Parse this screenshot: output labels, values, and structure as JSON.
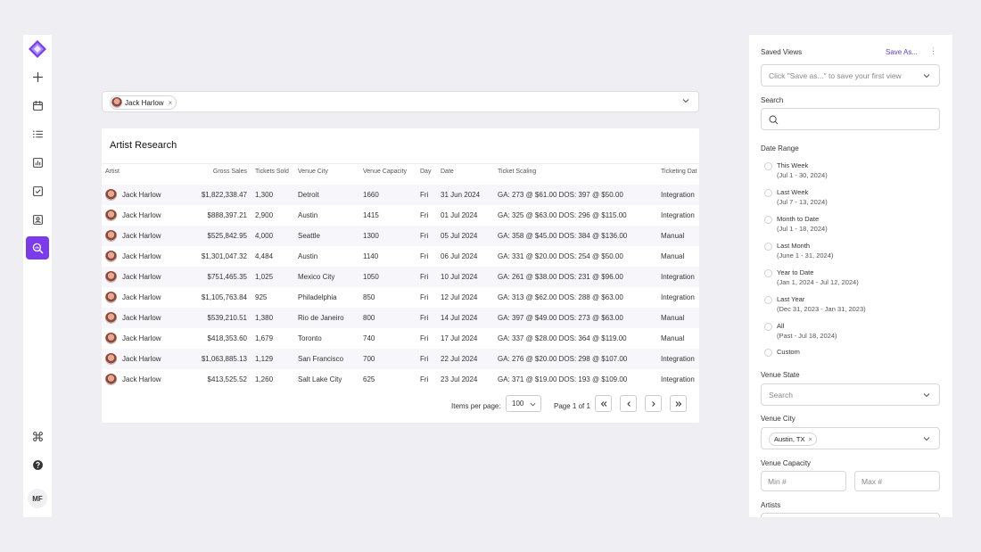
{
  "nav": {
    "items": [
      {
        "icon": "plus-icon"
      },
      {
        "icon": "calendar-icon"
      },
      {
        "icon": "list-icon"
      },
      {
        "icon": "chart-icon"
      },
      {
        "icon": "checkbox-icon"
      },
      {
        "icon": "contact-card-icon"
      },
      {
        "icon": "search-analytics-icon",
        "active": true
      }
    ],
    "bottom": [
      {
        "icon": "command-icon"
      },
      {
        "icon": "help-icon"
      }
    ],
    "user_initials": "MF"
  },
  "artist_filter": {
    "chip": "Jack Harlow"
  },
  "research": {
    "title": "Artist Research",
    "columns": [
      "Artist",
      "Gross Sales",
      "Tickets Sold",
      "Venue City",
      "Venue Capacity",
      "Day",
      "Date",
      "Ticket Scaling",
      "Ticketing Dat"
    ],
    "rows": [
      [
        "Jack Harlow",
        "$1,822,338.47",
        "1,300",
        "Detroit",
        "1660",
        "Fri",
        "31 Jun 2024",
        "GA: 273 @ $61.00 DOS: 397 @ $50.00",
        "Integration"
      ],
      [
        "Jack Harlow",
        "$888,397.21",
        "2,900",
        "Austin",
        "1415",
        "Fri",
        "01 Jul 2024",
        "GA: 325 @ $63.00 DOS: 296 @ $115.00",
        "Integration"
      ],
      [
        "Jack Harlow",
        "$525,842.95",
        "4,000",
        "Seattle",
        "1300",
        "Fri",
        "05 Jul 2024",
        "GA: 358 @ $45.00 DOS: 384 @ $136.00",
        "Manual"
      ],
      [
        "Jack Harlow",
        "$1,301,047.32",
        "4,484",
        "Austin",
        "1140",
        "Fri",
        "06 Jul 2024",
        "GA: 331 @ $20.00 DOS: 254 @ $50.00",
        "Manual"
      ],
      [
        "Jack Harlow",
        "$751,465.35",
        "1,025",
        "Mexico City",
        "1050",
        "Fri",
        "10 Jul 2024",
        "GA: 261 @ $38.00 DOS: 231 @ $96.00",
        "Integration"
      ],
      [
        "Jack Harlow",
        "$1,105,763.84",
        "925",
        "Philadelphia",
        "850",
        "Fri",
        "12 Jul 2024",
        "GA: 313 @ $62.00 DOS: 288 @ $63.00",
        "Integration"
      ],
      [
        "Jack Harlow",
        "$539,210.51",
        "1,380",
        "Rio de Janeiro",
        "800",
        "Fri",
        "14 Jul 2024",
        "GA: 397 @ $49.00 DOS: 273 @ $63.00",
        "Manual"
      ],
      [
        "Jack Harlow",
        "$418,353.60",
        "1,679",
        "Toronto",
        "740",
        "Fri",
        "17 Jul 2024",
        "GA: 337 @ $28.00 DOS: 364 @ $119.00",
        "Manual"
      ],
      [
        "Jack Harlow",
        "$1,063,885.13",
        "1,129",
        "San Francisco",
        "700",
        "Fri",
        "22 Jul 2024",
        "GA: 276 @ $20.00 DOS: 298 @ $107.00",
        "Integration"
      ],
      [
        "Jack Harlow",
        "$413,525.52",
        "1,260",
        "Salt Lake City",
        "625",
        "Fri",
        "23 Jul 2024",
        "GA: 371 @ $19.00 DOS: 193 @ $109.00",
        "Integration"
      ]
    ],
    "pagination": {
      "items_per_page_label": "Items per page:",
      "items_per_page": "100",
      "page_text": "Page 1 of 1"
    }
  },
  "panel": {
    "saved_views_label": "Saved Views",
    "save_as": "Save As...",
    "saved_views_placeholder": "Click \"Save as...\" to save your first view",
    "search_label": "Search",
    "date_range_label": "Date Range",
    "date_options": [
      {
        "title": "This Week",
        "sub": "(Jul 1 - 30, 2024)"
      },
      {
        "title": "Last Week",
        "sub": "(Jul 7 - 13, 2024)"
      },
      {
        "title": "Month to Date",
        "sub": "(Jul 1 - 18, 2024)"
      },
      {
        "title": "Last Month",
        "sub": "(June 1 - 31, 2024)"
      },
      {
        "title": "Year to Date",
        "sub": "(Jan 1, 2024 - Jul 12, 2024)"
      },
      {
        "title": "Last Year",
        "sub": "(Dec 31, 2023 - Jan 31, 2023)"
      },
      {
        "title": "All",
        "sub": "(Past - Jul 18, 2024)"
      },
      {
        "title": "Custom",
        "sub": ""
      }
    ],
    "venue_state_label": "Venue State",
    "venue_state_placeholder": "Search",
    "venue_city_label": "Venue City",
    "venue_city_chip": "Austin, TX",
    "venue_capacity_label": "Venue Capacity",
    "min_placeholder": "Min #",
    "max_placeholder": "Max #",
    "artists_label": "Artists"
  },
  "colors": {
    "accent": "#7c3aed",
    "link": "#5b3fd6"
  }
}
